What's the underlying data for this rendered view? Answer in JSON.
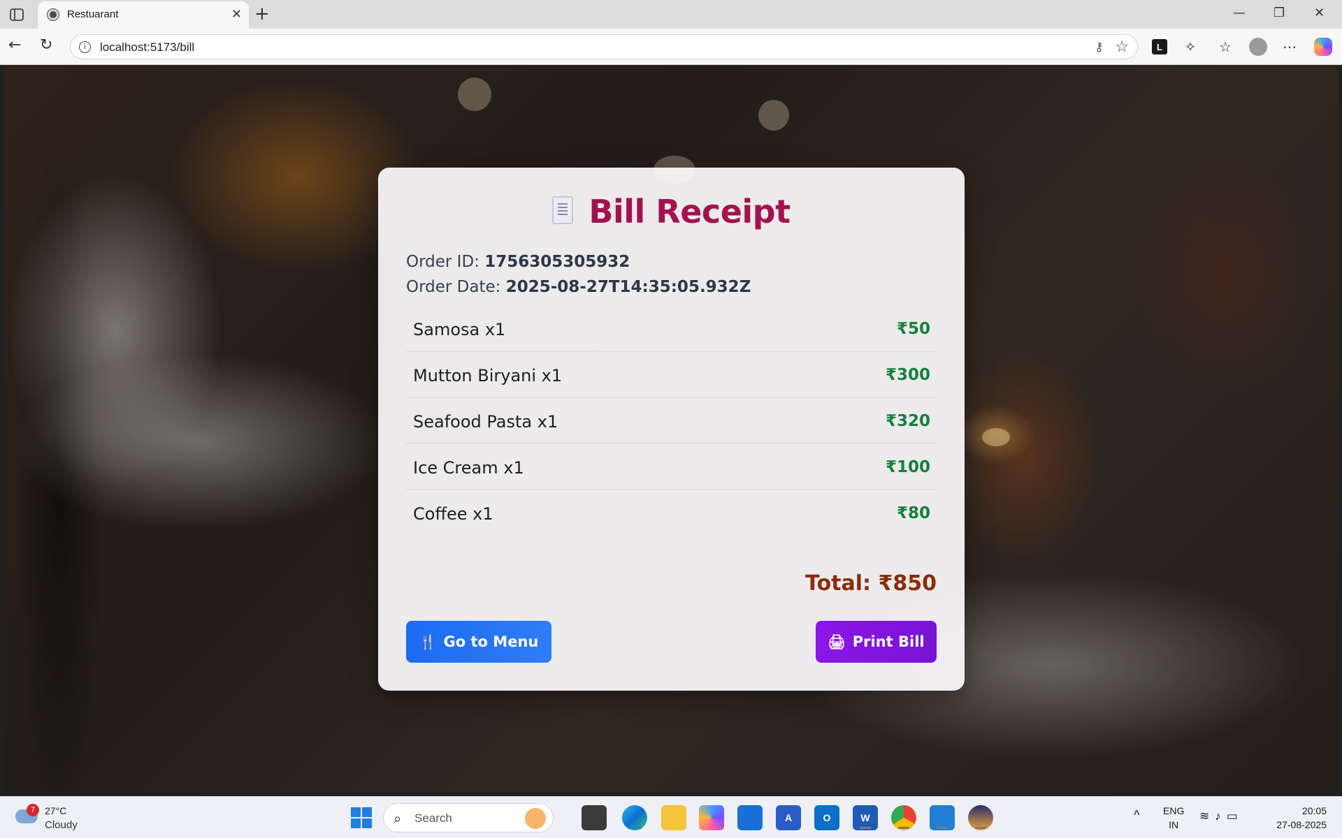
{
  "browser": {
    "tab_title": "Restuarant",
    "tab_close": "✕",
    "new_tab": "+",
    "url": "localhost:5173/bill",
    "window_controls": {
      "minimize": "—",
      "restore": "❐",
      "close": "✕"
    }
  },
  "receipt": {
    "title": "Bill Receipt",
    "order_id_label": "Order ID:",
    "order_id": "1756305305932",
    "order_date_label": "Order Date:",
    "order_date": "2025-08-27T14:35:05.932Z",
    "items": [
      {
        "name": "Samosa x1",
        "price": "₹50"
      },
      {
        "name": "Mutton Biryani x1",
        "price": "₹300"
      },
      {
        "name": "Seafood Pasta x1",
        "price": "₹320"
      },
      {
        "name": "Ice Cream x1",
        "price": "₹100"
      },
      {
        "name": "Coffee x1",
        "price": "₹80"
      }
    ],
    "total": "Total: ₹850",
    "menu_button": "Go to Menu",
    "print_button": "Print Bill",
    "colors": {
      "title": "#a3124f",
      "price": "#15803d",
      "total": "#8b2c0c",
      "menu_button": "#1d6bf3",
      "print_button": "#8b16e8"
    }
  },
  "taskbar": {
    "weather_badge": "7",
    "temperature": "27°C",
    "condition": "Cloudy",
    "search_placeholder": "Search",
    "language_line1": "ENG",
    "language_line2": "IN",
    "time": "20:05",
    "date": "27-08-2025"
  }
}
